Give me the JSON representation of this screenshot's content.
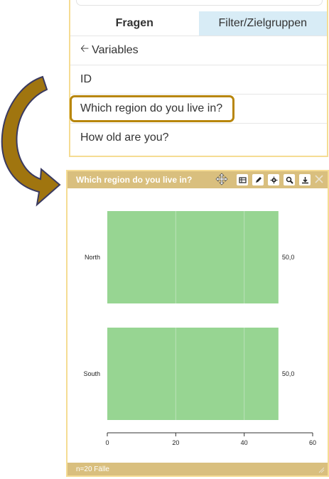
{
  "tabs": [
    {
      "label": "Fragen"
    },
    {
      "label": "Filter/Zielgruppen"
    }
  ],
  "variables": {
    "back_label": "Variables",
    "items": [
      "ID",
      "Which region do you live in?",
      "How old are you?"
    ]
  },
  "chart_window": {
    "title": "Which region do you live in?",
    "footer": "n=20 Fälle",
    "tools": [
      "table-icon",
      "pencil-icon",
      "gear-icon",
      "zoom-icon",
      "download-icon"
    ]
  },
  "colors": {
    "panel_border": "#f5dc93",
    "header_bg": "#d9bf7e",
    "highlight": "#b8860b",
    "bar": "#97d592",
    "tab_inactive": "#d8ecf6"
  },
  "chart_data": {
    "type": "bar",
    "orientation": "horizontal",
    "categories": [
      "North",
      "South"
    ],
    "values": [
      50.0,
      50.0
    ],
    "value_labels": [
      "50,0",
      "50,0"
    ],
    "xlim": [
      0,
      60
    ],
    "xticks": [
      "0",
      "20",
      "40",
      "60"
    ],
    "grid": true
  }
}
